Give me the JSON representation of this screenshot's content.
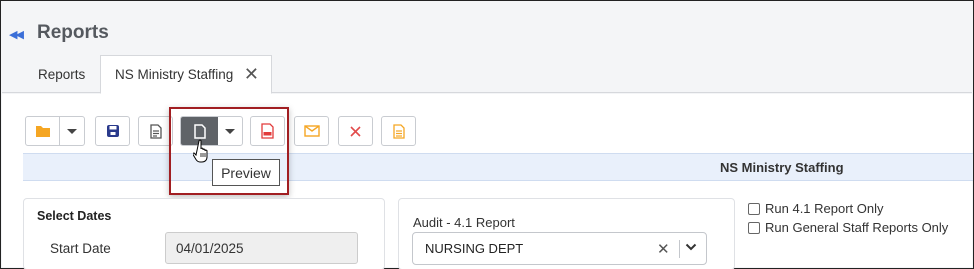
{
  "header": {
    "title": "Reports",
    "back_icon": "double-chevron-left-icon"
  },
  "tabs": [
    {
      "label": "Reports"
    },
    {
      "label": "NS Ministry Staffing",
      "close_icon": "close-icon"
    }
  ],
  "toolbar": {
    "buttons": [
      {
        "name": "open-folder",
        "icon": "folder-icon"
      },
      {
        "name": "save",
        "icon": "save-icon"
      },
      {
        "name": "document",
        "icon": "document-icon"
      },
      {
        "name": "preview",
        "icon": "file-icon"
      },
      {
        "name": "pdf",
        "icon": "pdf-icon"
      },
      {
        "name": "email",
        "icon": "envelope-icon"
      },
      {
        "name": "delete",
        "icon": "close-icon"
      },
      {
        "name": "notes",
        "icon": "note-icon"
      }
    ],
    "tooltip": "Preview"
  },
  "banner": {
    "title": "NS Ministry Staffing"
  },
  "select_dates": {
    "title": "Select Dates",
    "start_label": "Start Date",
    "start_value": "04/01/2025"
  },
  "audit": {
    "label": "Audit - 4.1 Report",
    "value": "NURSING DEPT",
    "clear": "✕"
  },
  "options": [
    {
      "label": "Run 4.1 Report Only",
      "checked": false
    },
    {
      "label": "Run General Staff Reports Only",
      "checked": false
    }
  ],
  "colors": {
    "folder": "#f5a623",
    "save": "#2a3a8c",
    "pdf": "#e23b3b",
    "email": "#f5a623",
    "delete": "#e24b4b",
    "notes": "#f5a623",
    "highlight": "#a11e22",
    "banner": "#e9f0fb"
  }
}
